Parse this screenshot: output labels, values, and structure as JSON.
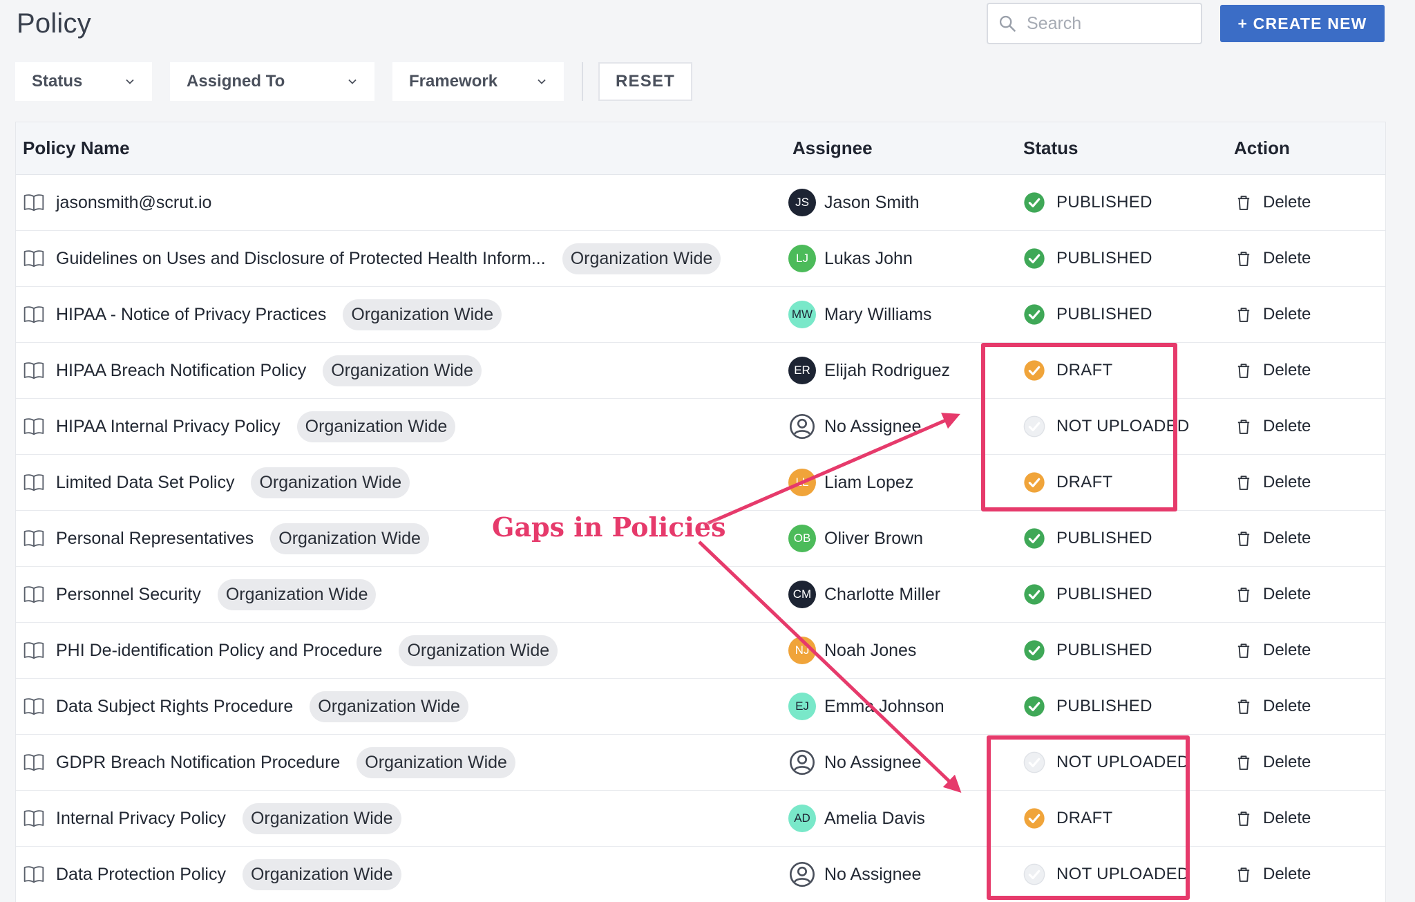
{
  "page": {
    "title": "Policy"
  },
  "search": {
    "placeholder": "Search"
  },
  "actions": {
    "create_label": "+ CREATE NEW",
    "reset_label": "RESET"
  },
  "filters": [
    {
      "label": "Status"
    },
    {
      "label": "Assigned To"
    },
    {
      "label": "Framework"
    }
  ],
  "table": {
    "headers": {
      "name": "Policy Name",
      "assignee": "Assignee",
      "status": "Status",
      "action": "Action"
    },
    "action_label": "Delete",
    "rows": [
      {
        "name": "jasonsmith@scrut.io",
        "tag": "",
        "assignee": "Jason Smith",
        "initials": "JS",
        "avatar_color": "#1d2433",
        "avatar_text": "#ffffff",
        "status": "PUBLISHED",
        "status_type": "published"
      },
      {
        "name": "Guidelines on Uses and Disclosure of Protected Health Inform...",
        "tag": "Organization Wide",
        "assignee": "Lukas John",
        "initials": "LJ",
        "avatar_color": "#4cbb5a",
        "avatar_text": "#ffffff",
        "status": "PUBLISHED",
        "status_type": "published"
      },
      {
        "name": "HIPAA - Notice of Privacy Practices",
        "tag": "Organization Wide",
        "assignee": "Mary Williams",
        "initials": "MW",
        "avatar_color": "#79e8c9",
        "avatar_text": "#1d2433",
        "status": "PUBLISHED",
        "status_type": "published"
      },
      {
        "name": "HIPAA Breach Notification Policy",
        "tag": "Organization Wide",
        "assignee": "Elijah Rodriguez",
        "initials": "ER",
        "avatar_color": "#1d2433",
        "avatar_text": "#ffffff",
        "status": "DRAFT",
        "status_type": "draft"
      },
      {
        "name": "HIPAA Internal Privacy Policy",
        "tag": "Organization Wide",
        "assignee": "No Assignee",
        "initials": "",
        "avatar_color": "",
        "avatar_text": "",
        "status": "NOT UPLOADED",
        "status_type": "not_uploaded"
      },
      {
        "name": "Limited Data Set Policy",
        "tag": "Organization Wide",
        "assignee": "Liam Lopez",
        "initials": "LL",
        "avatar_color": "#f0a43a",
        "avatar_text": "#ffffff",
        "status": "DRAFT",
        "status_type": "draft"
      },
      {
        "name": "Personal Representatives",
        "tag": "Organization Wide",
        "assignee": "Oliver Brown",
        "initials": "OB",
        "avatar_color": "#4cbb5a",
        "avatar_text": "#ffffff",
        "status": "PUBLISHED",
        "status_type": "published"
      },
      {
        "name": "Personnel Security",
        "tag": "Organization Wide",
        "assignee": "Charlotte Miller",
        "initials": "CM",
        "avatar_color": "#1d2433",
        "avatar_text": "#ffffff",
        "status": "PUBLISHED",
        "status_type": "published"
      },
      {
        "name": "PHI De-identification Policy and Procedure",
        "tag": "Organization Wide",
        "assignee": "Noah Jones",
        "initials": "NJ",
        "avatar_color": "#f0a43a",
        "avatar_text": "#ffffff",
        "status": "PUBLISHED",
        "status_type": "published"
      },
      {
        "name": "Data Subject Rights Procedure",
        "tag": "Organization Wide",
        "assignee": "Emma Johnson",
        "initials": "EJ",
        "avatar_color": "#79e8c9",
        "avatar_text": "#1d2433",
        "status": "PUBLISHED",
        "status_type": "published"
      },
      {
        "name": "GDPR Breach Notification Procedure",
        "tag": "Organization Wide",
        "assignee": "No Assignee",
        "initials": "",
        "avatar_color": "",
        "avatar_text": "",
        "status": "NOT UPLOADED",
        "status_type": "not_uploaded"
      },
      {
        "name": "Internal Privacy Policy",
        "tag": "Organization Wide",
        "assignee": "Amelia Davis",
        "initials": "AD",
        "avatar_color": "#79e8c9",
        "avatar_text": "#1d2433",
        "status": "DRAFT",
        "status_type": "draft"
      },
      {
        "name": "Data Protection Policy",
        "tag": "Organization Wide",
        "assignee": "No Assignee",
        "initials": "",
        "avatar_color": "",
        "avatar_text": "",
        "status": "NOT UPLOADED",
        "status_type": "not_uploaded"
      }
    ]
  },
  "annotation": {
    "text": "Gaps in Policies",
    "color": "#e63a6b"
  },
  "colors": {
    "primary": "#3b6dc6",
    "published": "#3fa857",
    "draft": "#f0a43a",
    "not_uploaded": "#dfe2e7"
  }
}
